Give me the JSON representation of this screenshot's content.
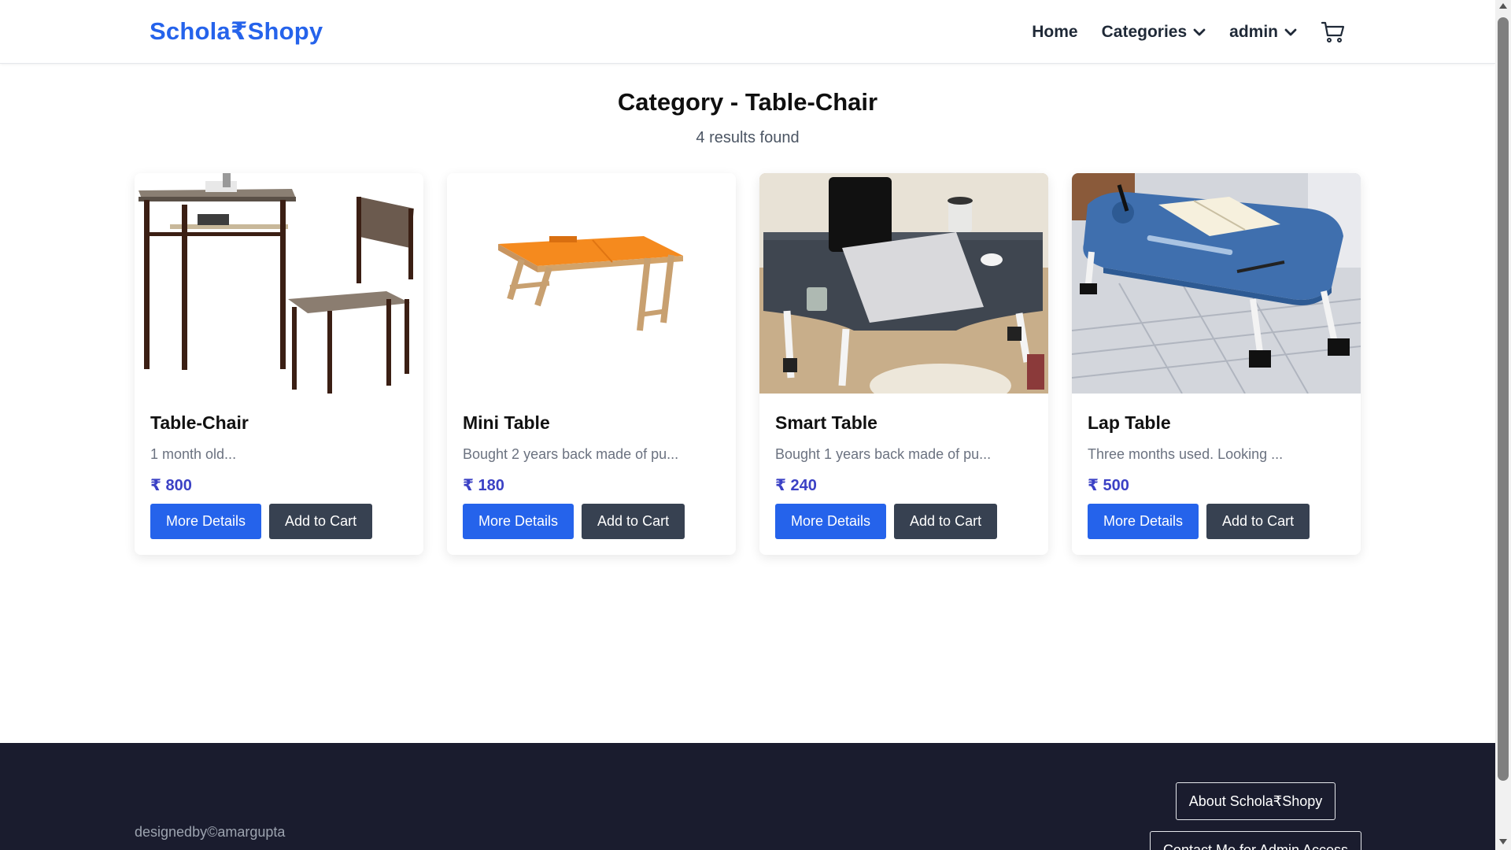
{
  "brand": {
    "name": "Schola₹Shopy",
    "color": "#2563eb"
  },
  "nav": {
    "home": "Home",
    "categories": "Categories",
    "user": "admin",
    "cart_icon": "shopping-cart-icon"
  },
  "page": {
    "title": "Category - Table-Chair",
    "results": "4 results found"
  },
  "products": [
    {
      "name": "Table-Chair",
      "description": "1 month old...",
      "price": "₹ 800",
      "more": "More Details",
      "add": "Add to Cart"
    },
    {
      "name": "Mini Table",
      "description": "Bought 2 years back made of pu...",
      "price": "₹ 180",
      "more": "More Details",
      "add": "Add to Cart"
    },
    {
      "name": "Smart Table",
      "description": "Bought 1 years back made of pu...",
      "price": "₹ 240",
      "more": "More Details",
      "add": "Add to Cart"
    },
    {
      "name": "Lap Table",
      "description": "Three months used. Looking ...",
      "price": "₹ 500",
      "more": "More Details",
      "add": "Add to Cart"
    }
  ],
  "footer": {
    "credit": "designedby©amargupta",
    "about": "About Schola₹Shopy",
    "contact": "Contact Me for Admin Access"
  },
  "colors": {
    "primary": "#2563eb",
    "dark_button": "#374151",
    "price": "#3b41c5",
    "footer_bg": "#1a1c2e"
  }
}
